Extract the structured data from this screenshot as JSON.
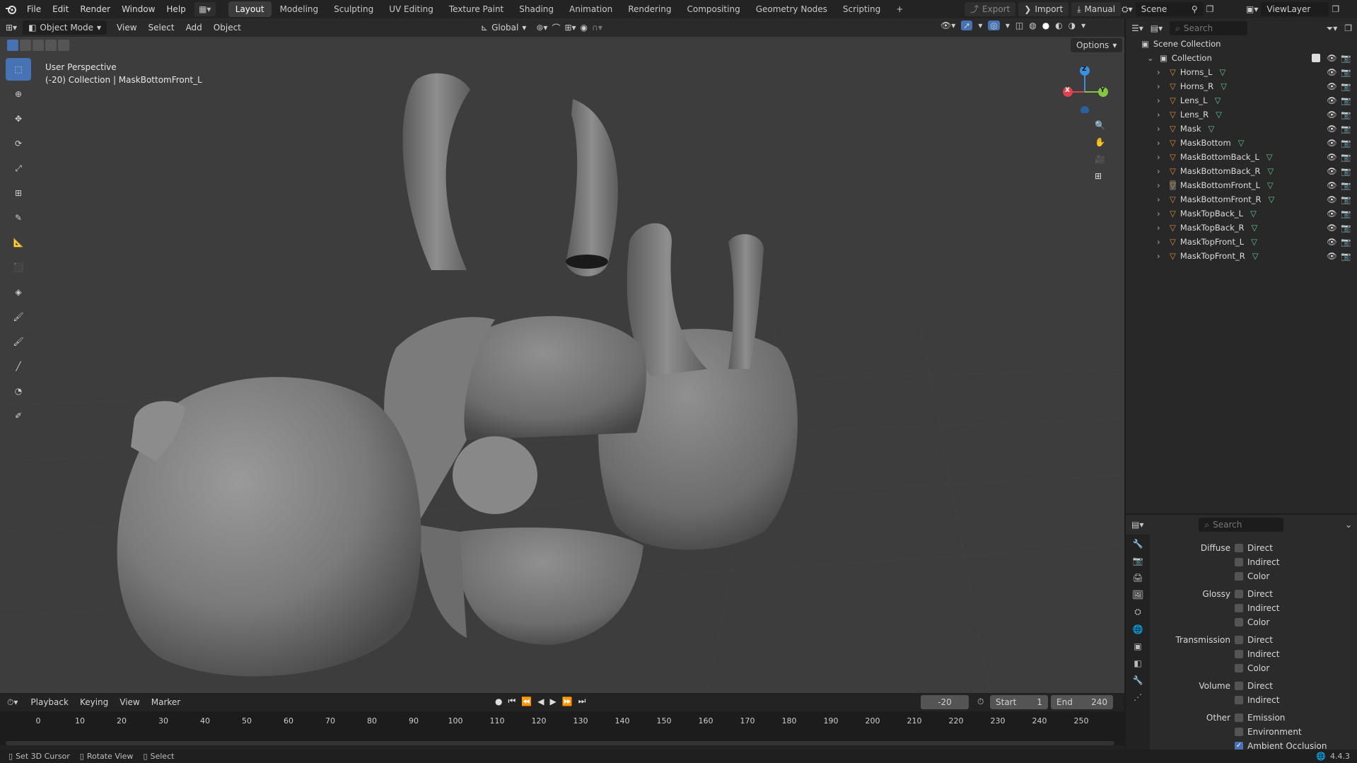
{
  "topbar": {
    "menus": [
      "File",
      "Edit",
      "Render",
      "Window",
      "Help"
    ],
    "workspaces": [
      "Layout",
      "Modeling",
      "Sculpting",
      "UV Editing",
      "Texture Paint",
      "Shading",
      "Animation",
      "Rendering",
      "Compositing",
      "Geometry Nodes",
      "Scripting"
    ],
    "active_workspace": "Layout",
    "export_label": "Export",
    "import_label": "Import",
    "manual_label": "Manual",
    "scene_label": "Scene",
    "viewlayer_label": "ViewLayer"
  },
  "viewport_header": {
    "mode": "Object Mode",
    "menus": [
      "View",
      "Select",
      "Add",
      "Object"
    ],
    "orientation": "Global",
    "options_label": "Options"
  },
  "viewport": {
    "perspective_label": "User Perspective",
    "context_label": "(-20) Collection | MaskBottomFront_L",
    "gizmo": {
      "x": "X",
      "y": "Y",
      "z": "Z"
    }
  },
  "outliner": {
    "search_placeholder": "Search",
    "scene_collection": "Scene Collection",
    "collection": "Collection",
    "objects": [
      "Horns_L",
      "Horns_R",
      "Lens_L",
      "Lens_R",
      "Mask",
      "MaskBottom",
      "MaskBottomBack_L",
      "MaskBottomBack_R",
      "MaskBottomFront_L",
      "MaskBottomFront_R",
      "MaskTopBack_L",
      "MaskTopBack_R",
      "MaskTopFront_L",
      "MaskTopFront_R"
    ],
    "selected_object": "MaskBottomFront_L"
  },
  "properties": {
    "search_placeholder": "Search",
    "groups": [
      {
        "label": "Diffuse",
        "items": [
          {
            "label": "Direct",
            "checked": false
          },
          {
            "label": "Indirect",
            "checked": false
          },
          {
            "label": "Color",
            "checked": false
          }
        ]
      },
      {
        "label": "Glossy",
        "items": [
          {
            "label": "Direct",
            "checked": false
          },
          {
            "label": "Indirect",
            "checked": false
          },
          {
            "label": "Color",
            "checked": false
          }
        ]
      },
      {
        "label": "Transmission",
        "items": [
          {
            "label": "Direct",
            "checked": false
          },
          {
            "label": "Indirect",
            "checked": false
          },
          {
            "label": "Color",
            "checked": false
          }
        ]
      },
      {
        "label": "Volume",
        "items": [
          {
            "label": "Direct",
            "checked": false
          },
          {
            "label": "Indirect",
            "checked": false
          }
        ]
      },
      {
        "label": "Other",
        "items": [
          {
            "label": "Emission",
            "checked": false
          },
          {
            "label": "Environment",
            "checked": false
          },
          {
            "label": "Ambient Occlusion",
            "checked": true
          }
        ]
      }
    ]
  },
  "timeline": {
    "menus": [
      "Playback",
      "Keying",
      "View",
      "Marker"
    ],
    "current_frame": "-20",
    "start_label": "Start",
    "start_value": "1",
    "end_label": "End",
    "end_value": "240",
    "ticks": [
      "0",
      "10",
      "20",
      "30",
      "40",
      "50",
      "60",
      "70",
      "80",
      "90",
      "100",
      "110",
      "120",
      "130",
      "140",
      "150",
      "160",
      "170",
      "180",
      "190",
      "200",
      "210",
      "220",
      "230",
      "240",
      "250"
    ]
  },
  "statusbar": {
    "hint1": "Set 3D Cursor",
    "hint2": "Rotate View",
    "hint3": "Select",
    "version": "4.4.3"
  },
  "colors": {
    "accent": "#4772b3",
    "mesh_icon": "#e08a3c",
    "vertex_icon": "#5fc48c",
    "gizmo_x": "#e0414f",
    "gizmo_y": "#86c540",
    "gizmo_z": "#3b8fe0"
  }
}
